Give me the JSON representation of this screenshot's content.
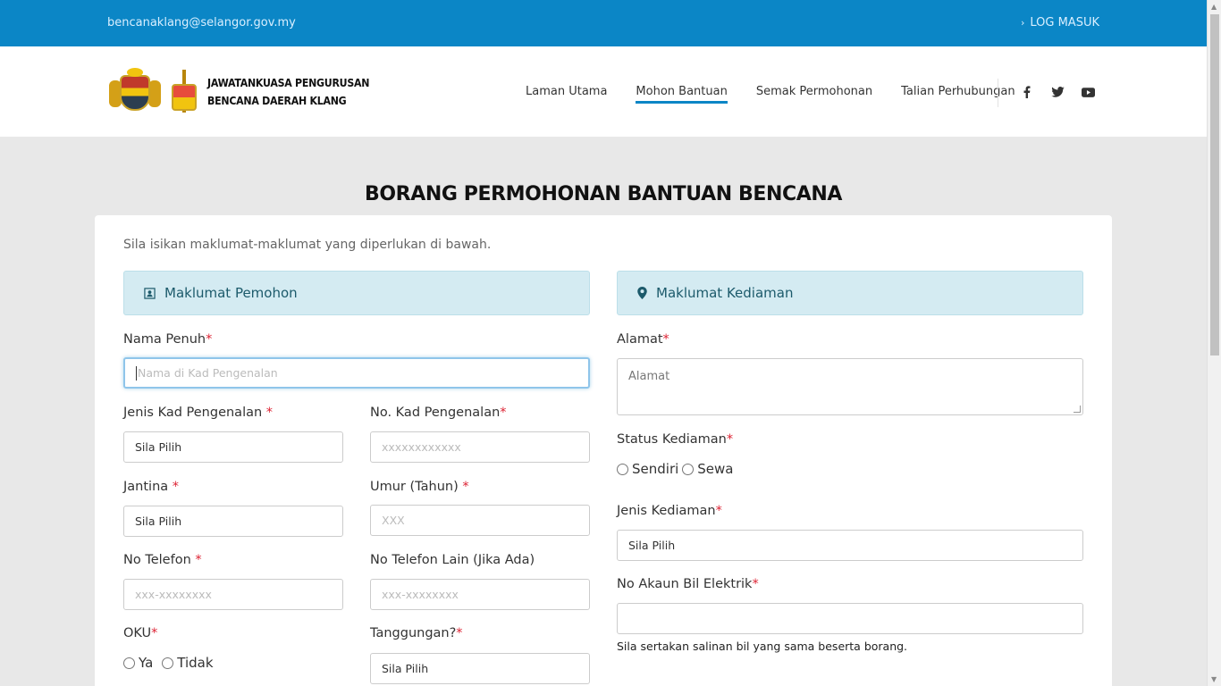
{
  "topbar": {
    "email": "bencanaklang@selangor.gov.my",
    "login_label": "LOG MASUK"
  },
  "header": {
    "logo_line1": "JAWATANKUASA PENGURUSAN",
    "logo_line2": "BENCANA DAERAH KLANG",
    "nav": [
      "Laman Utama",
      "Mohon Bantuan",
      "Semak Permohonan",
      "Talian Perhubungan"
    ],
    "active_nav": "Mohon Bantuan",
    "social_icons": [
      "facebook-icon",
      "twitter-icon",
      "youtube-icon"
    ]
  },
  "page_title": "BORANG PERMOHONAN BANTUAN BENCANA",
  "form": {
    "intro": "Sila isikan maklumat-maklumat yang diperlukan di bawah.",
    "panel_left": "Maklumat Pemohon",
    "panel_right": "Maklumat Kediaman",
    "required_mark": "*",
    "nama_label": "Nama Penuh",
    "nama_placeholder": "Nama di Kad Pengenalan",
    "jenis_kp_label": "Jenis Kad Pengenalan",
    "jenis_kp_value": "Sila Pilih",
    "no_kp_label": "No. Kad Pengenalan",
    "no_kp_placeholder": "xxxxxxxxxxxx",
    "jantina_label": "Jantina",
    "jantina_value": "Sila Pilih",
    "umur_label": "Umur (Tahun)",
    "umur_placeholder": "XXX",
    "telefon_label": "No Telefon",
    "telefon_placeholder": "xxx-xxxxxxxx",
    "telefon_lain_label": "No Telefon Lain (Jika Ada)",
    "telefon_lain_placeholder": "xxx-xxxxxxxx",
    "oku_label": "OKU",
    "oku_ya": "Ya",
    "oku_tidak": "Tidak",
    "tanggungan_label": "Tanggungan?",
    "tanggungan_value": "Sila Pilih",
    "alamat_label": "Alamat",
    "alamat_placeholder": "Alamat",
    "status_label": "Status Kediaman",
    "status_sendiri": "Sendiri",
    "status_sewa": "Sewa",
    "jenis_kediaman_label": "Jenis Kediaman",
    "jenis_kediaman_value": "Sila Pilih",
    "akaun_label": "No Akaun Bil Elektrik",
    "akaun_value": "",
    "akaun_note": "Sila sertakan salinan bil yang sama beserta borang."
  },
  "colors": {
    "brand": "#0b86c6",
    "panel": "#d4ebf2",
    "required": "#dd2233"
  }
}
